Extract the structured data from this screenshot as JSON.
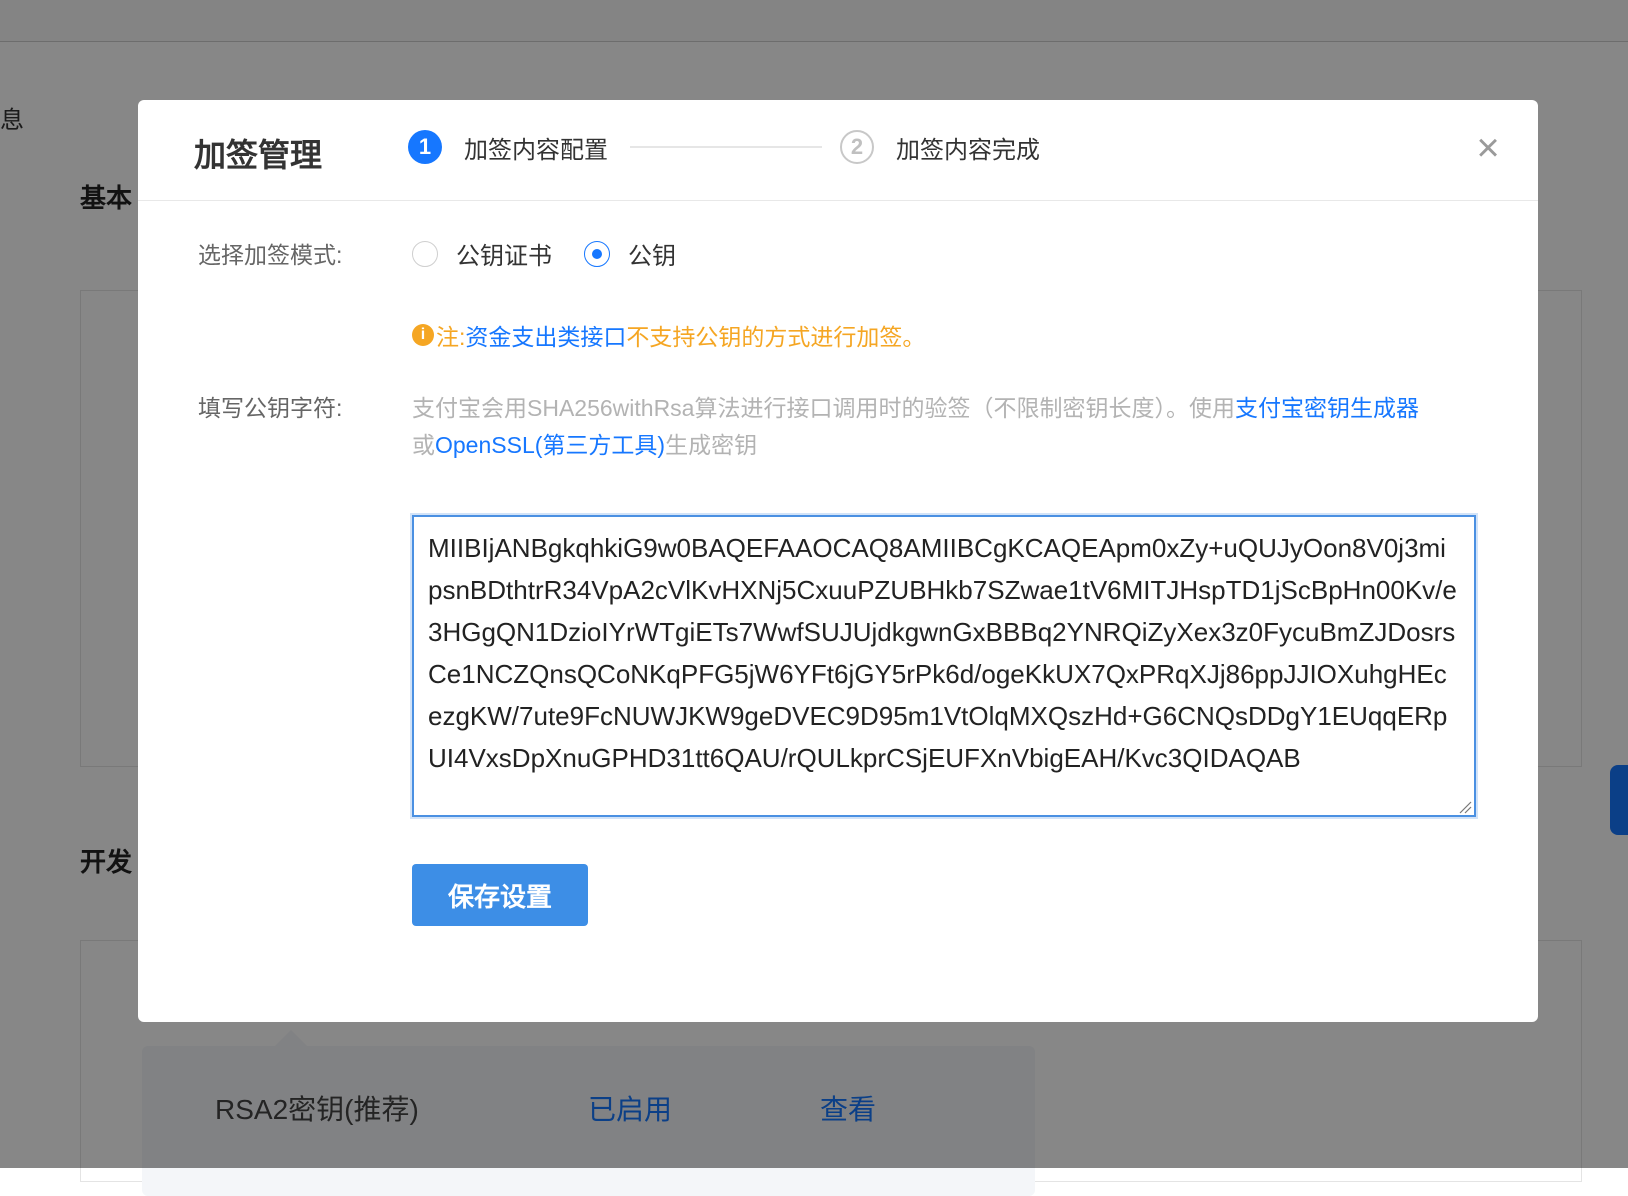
{
  "background": {
    "left_fragment": "息",
    "section_basic": "基本",
    "section_dev": "开发",
    "key_row": {
      "name": "RSA2密钥(推荐)",
      "status": "已启用",
      "action": "查看"
    }
  },
  "modal": {
    "title": "加签管理",
    "steps": [
      {
        "number": "1",
        "label": "加签内容配置",
        "state": "active"
      },
      {
        "number": "2",
        "label": "加签内容完成",
        "state": "inactive"
      }
    ],
    "close_icon": "×",
    "sign_mode": {
      "label": "选择加签模式:",
      "options": [
        {
          "label": "公钥证书",
          "checked": false
        },
        {
          "label": "公钥",
          "checked": true
        }
      ]
    },
    "note": {
      "icon": "i",
      "prefix": "注:",
      "link": "资金支出类接口",
      "suffix": "不支持公钥的方式进行加签。"
    },
    "public_key": {
      "label": "填写公钥字符:",
      "hint_prefix": "支付宝会用SHA256withRsa算法进行接口调用时的验签（不限制密钥长度）。使用",
      "hint_link1": "支付宝密钥生成器",
      "hint_mid": "或",
      "hint_link2": "OpenSSL(第三方工具)",
      "hint_suffix": "生成密钥",
      "value": "MIIBIjANBgkqhkiG9w0BAQEFAAOCAQ8AMIIBCgKCAQEApm0xZy+uQUJyOon8V0j3mipsnBDthtrR34VpA2cVlKvHXNj5CxuuPZUBHkb7SZwae1tV6MITJHspTD1jScBpHn00Kv/e3HGgQN1DzioIYrWTgiETs7WwfSUJUjdkgwnGxBBBq2YNRQiZyXex3z0FycuBmZJDosrsCe1NCZQnsQCoNKqPFG5jW6YFt6jGY5rPk6d/ogeKkUX7QxPRqXJj86ppJJIOXuhgHEcezgKW/7ute9FcNUWJKW9geDVEC9D95m1VtOlqMXQszHd+G6CNQsDDgY1EUqqERpUI4VxsDpXnuGPHD31tt6QAU/rQULkprCSjEUFXnVbigEAH/Kvc3QIDAQAB"
    },
    "save_button": "保存设置"
  },
  "colors": {
    "primary": "#1677ff",
    "button": "#3d8ee6",
    "warning": "#f5a623",
    "overlay": "rgba(0,0,0,0.47)"
  }
}
